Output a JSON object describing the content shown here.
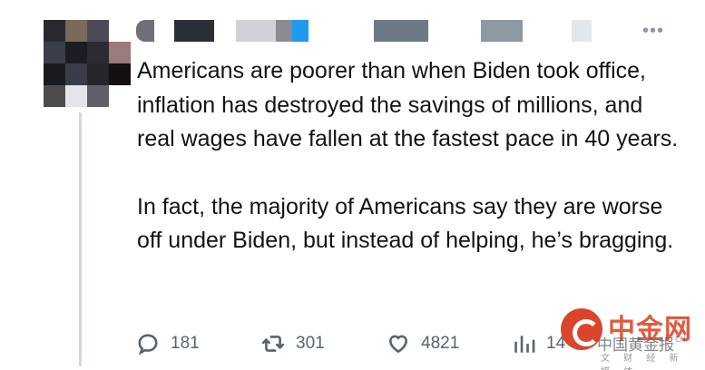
{
  "tweet": {
    "paragraphs": [
      "Americans are poorer than when Biden took office, inflation has destroyed the savings of millions, and real wages have fallen at the fastest pace in 40 years.",
      "In fact, the majority of Americans say they are worse off under Biden, but instead of helping, he’s bragging."
    ]
  },
  "actions": {
    "replies": "181",
    "retweets": "301",
    "likes": "4821",
    "views": "14"
  },
  "icons": {
    "reply": "reply-icon",
    "retweet": "retweet-icon",
    "like": "heart-icon",
    "views": "views-icon",
    "more": "more-icon"
  },
  "more_glyph": "•••",
  "watermark": {
    "title": "中金网",
    "subtitle": "中国黄金报",
    "tagline": "文 财 经 新 媒 体",
    "small": "CN"
  },
  "colors": {
    "text": "#0f1419",
    "secondary": "#536471",
    "thread_line": "#cfd9de",
    "watermark_red": "#d9452b"
  }
}
